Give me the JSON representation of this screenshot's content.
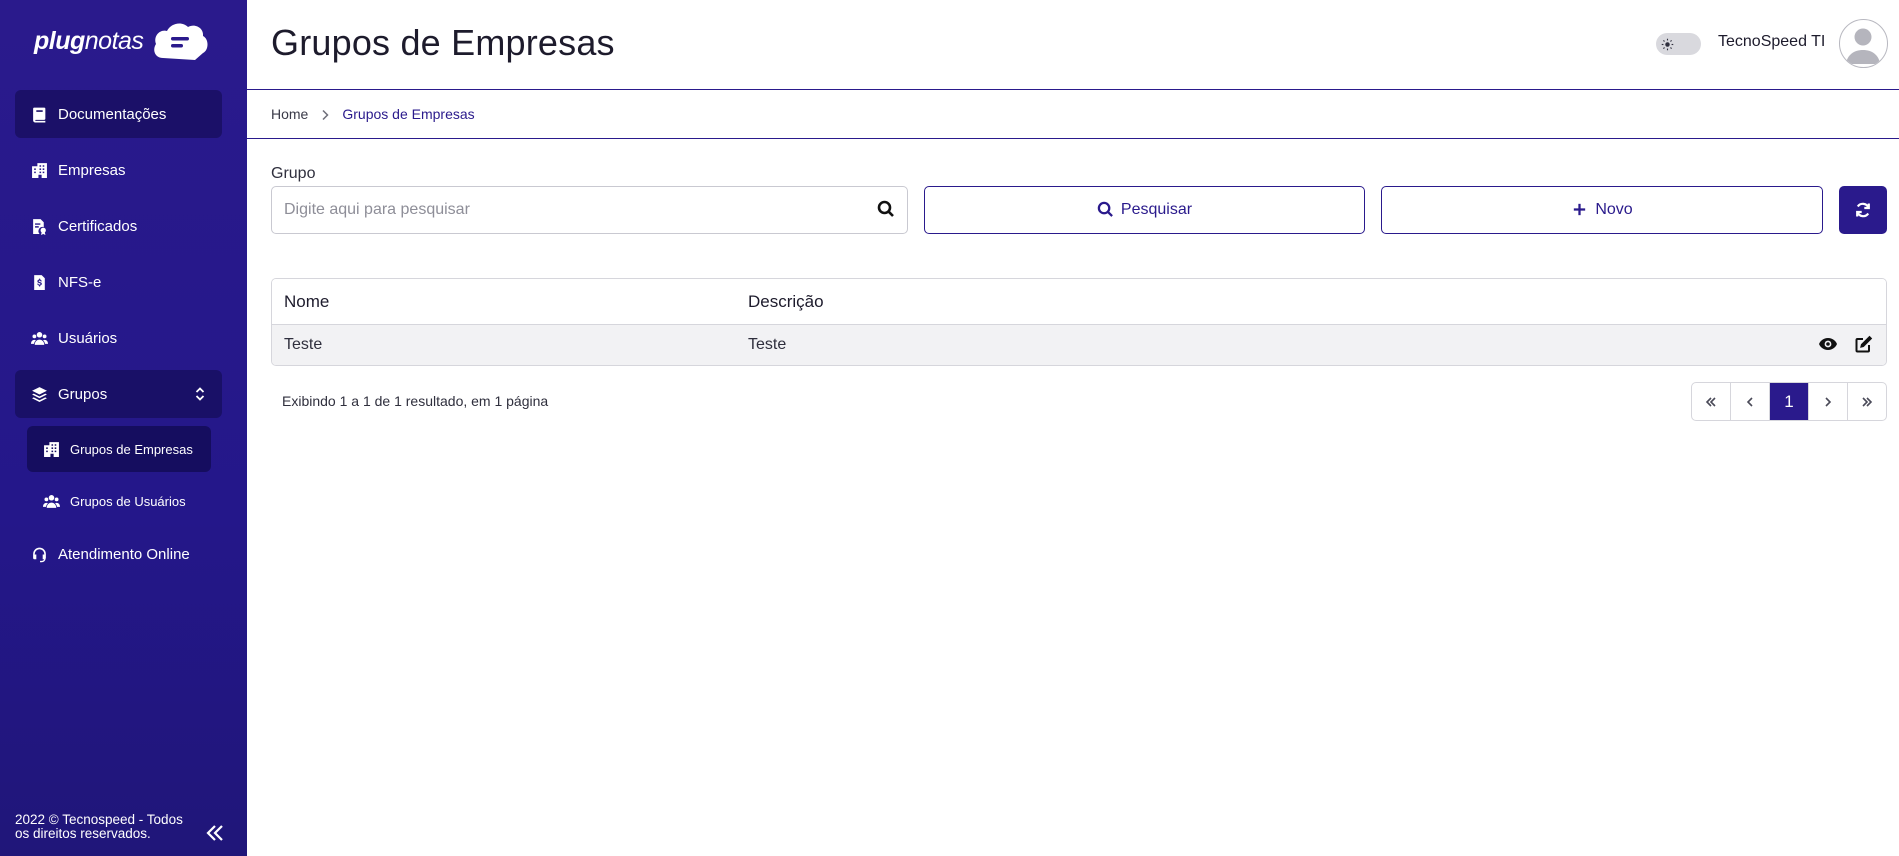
{
  "brand": {
    "logo_bold": "plug",
    "logo_light": "notas"
  },
  "colors": {
    "primary": "#2a1a8c",
    "sidebar_bg": "#24178a",
    "row_bg": "#f2f2f4"
  },
  "sidebar": {
    "items": [
      {
        "label": "Documentações",
        "icon": "book-icon",
        "active": true
      },
      {
        "label": "Empresas",
        "icon": "building-icon"
      },
      {
        "label": "Certificados",
        "icon": "certificate-icon"
      },
      {
        "label": "NFS-e",
        "icon": "invoice-icon"
      },
      {
        "label": "Usuários",
        "icon": "users-icon"
      },
      {
        "label": "Grupos",
        "icon": "layers-icon",
        "expanded": true
      },
      {
        "label": "Atendimento Online",
        "icon": "headset-icon"
      }
    ],
    "subitems": [
      {
        "label": "Grupos de Empresas",
        "icon": "building-icon",
        "active": true
      },
      {
        "label": "Grupos de Usuários",
        "icon": "users-icon"
      }
    ],
    "footer": "2022 © Tecnospeed - Todos os direitos reservados."
  },
  "header": {
    "title": "Grupos de Empresas",
    "user_name": "TecnoSpeed TI"
  },
  "breadcrumb": {
    "home": "Home",
    "current": "Grupos de Empresas"
  },
  "search": {
    "label": "Grupo",
    "placeholder": "Digite aqui para pesquisar",
    "value": ""
  },
  "buttons": {
    "search_label": "Pesquisar",
    "new_label": "Novo"
  },
  "table": {
    "columns": [
      "Nome",
      "Descrição"
    ],
    "rows": [
      {
        "nome": "Teste",
        "descricao": "Teste"
      }
    ]
  },
  "pagination": {
    "results_text": "Exibindo 1 a 1 de 1 resultado, em 1 página",
    "current_page": "1"
  }
}
